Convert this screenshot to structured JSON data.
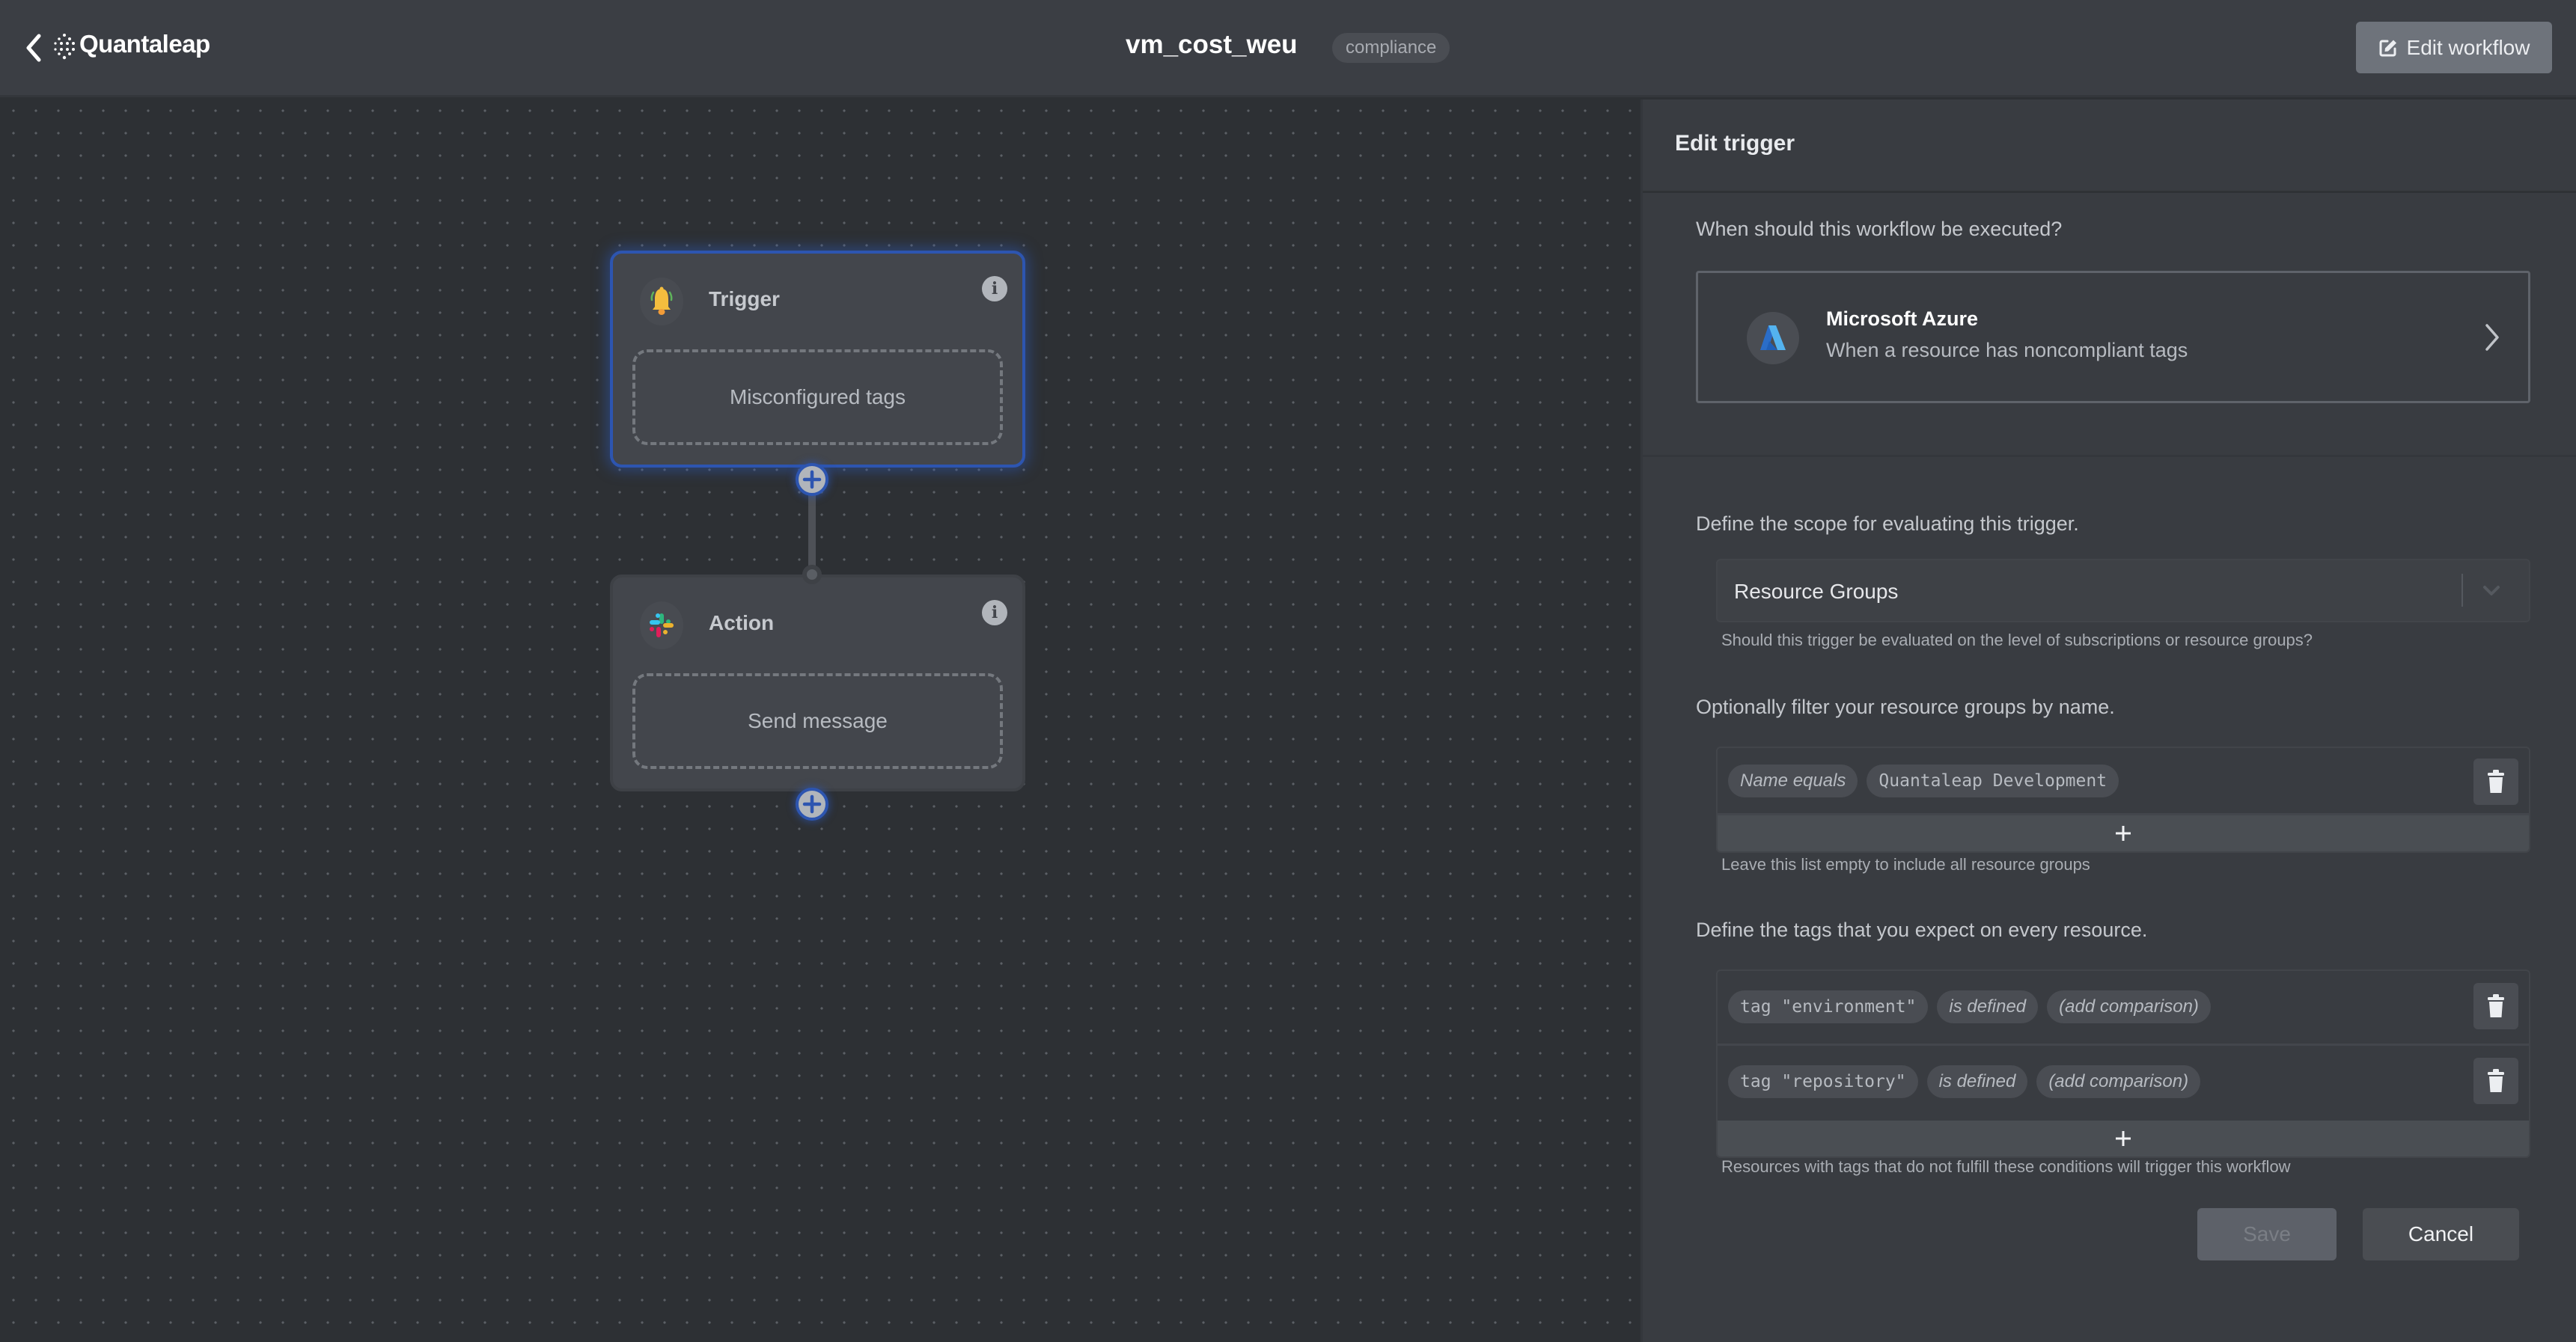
{
  "header": {
    "back_icon": "chevron-left-icon",
    "brand": "Quantaleap",
    "workflow_title": "vm_cost_weu",
    "workflow_badge": "compliance",
    "edit_workflow_label": "Edit workflow",
    "edit_workflow_icon": "edit-square-icon"
  },
  "canvas": {
    "nodes": [
      {
        "kind": "trigger",
        "title": "Trigger",
        "icon": "bell-icon",
        "body": "Misconfigured tags",
        "selected": true
      },
      {
        "kind": "action",
        "title": "Action",
        "icon": "slack-icon",
        "body": "Send message",
        "selected": false
      }
    ],
    "add_step_icon": "plus-circle-icon",
    "info_icon": "info-icon"
  },
  "panel": {
    "title": "Edit trigger",
    "when_label": "When should this workflow be executed?",
    "trigger_card": {
      "provider": "Microsoft Azure",
      "description": "When a resource has noncompliant tags",
      "icon": "azure-icon"
    },
    "scope_label": "Define the scope for evaluating this trigger.",
    "scope_select": {
      "value": "Resource Groups"
    },
    "scope_help": "Should this trigger be evaluated on the level of subscriptions or resource groups?",
    "filter_label": "Optionally filter your resource groups by name.",
    "filters": [
      {
        "operator": "Name equals",
        "value": "Quantaleap Development"
      }
    ],
    "filter_help": "Leave this list empty to include all resource groups",
    "tags_label": "Define the tags that you expect on every resource.",
    "tags": [
      {
        "tag": "tag \"environment\"",
        "condition": "is defined",
        "comparison": "(add comparison)"
      },
      {
        "tag": "tag \"repository\"",
        "condition": "is defined",
        "comparison": "(add comparison)"
      }
    ],
    "tags_help": "Resources with tags that do not fulfill these conditions will trigger this workflow",
    "save_label": "Save",
    "cancel_label": "Cancel"
  },
  "colors": {
    "selection_accent": "#2d55b0",
    "bell": "#f4bd3e",
    "azure": "#2f7bd6"
  }
}
